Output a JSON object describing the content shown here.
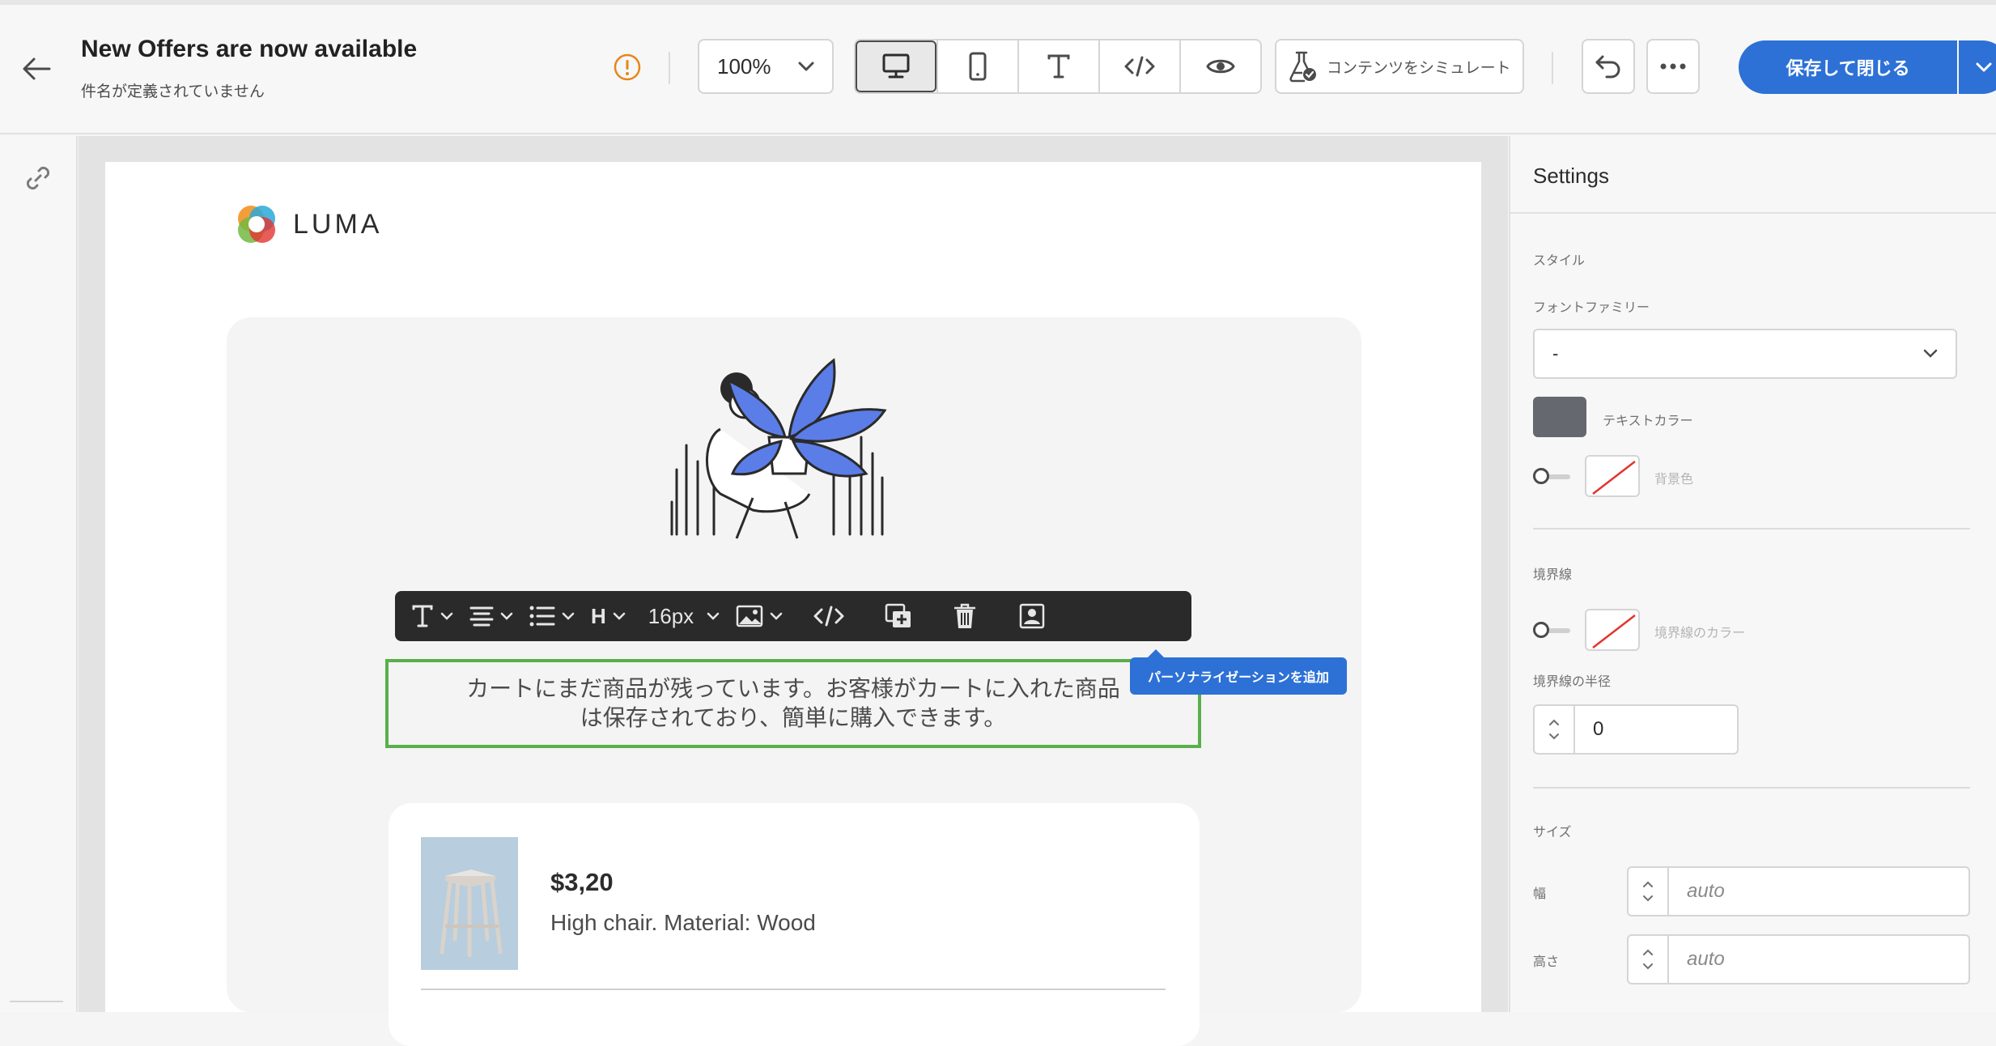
{
  "header": {
    "title": "New Offers are now available",
    "subtitle": "件名が定義されていません",
    "zoom_value": "100%",
    "simulate_label": "コンテンツをシミュレート",
    "save_label": "保存して閉じる"
  },
  "email": {
    "logo_text": "LUMA",
    "toolbar": {
      "font_size": "16px",
      "heading": "H"
    },
    "body_text_line1": "カートにまだ商品が残っています。お客様がカートに入れた商品",
    "body_text_line2": "は保存されており、簡単に購入できます。",
    "tooltip": "パーソナライゼーションを追加",
    "product": {
      "price": "$3,20",
      "description": "High chair. Material: Wood"
    }
  },
  "settings": {
    "title": "Settings",
    "style_section": "スタイル",
    "font_family_label": "フォントファミリー",
    "font_family_value": "-",
    "text_color_label": "テキストカラー",
    "background_label": "背景色",
    "border_section": "境界線",
    "border_color_label": "境界線のカラー",
    "border_radius_label": "境界線の半径",
    "border_radius_value": "0",
    "size_section": "サイズ",
    "width_label": "幅",
    "width_value": "auto",
    "height_label": "高さ",
    "height_value": "auto"
  },
  "colors": {
    "accent": "#2d71d6",
    "selection": "#58b04a",
    "warning": "#e68619",
    "text_color_swatch": "#666870",
    "illustration_blue": "#5b7de8"
  }
}
